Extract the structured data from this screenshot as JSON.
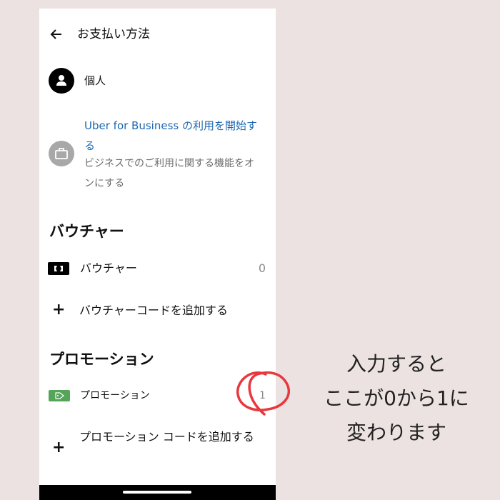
{
  "header": {
    "title": "お支払い方法",
    "back_icon": "arrow-left-icon"
  },
  "personal": {
    "label": "個人",
    "icon": "person-icon"
  },
  "uber_business": {
    "title": "Uber for Business の利用を開始する",
    "subtitle": "ビジネスでのご利用に関する機能をオンにする",
    "icon": "briefcase-icon"
  },
  "voucher_section": {
    "heading": "バウチャー",
    "item_label": "バウチャー",
    "count": "0",
    "add_label": "バウチャーコードを追加する",
    "add_icon": "plus-icon",
    "item_icon": "ticket-icon"
  },
  "promo_section": {
    "heading": "プロモーション",
    "item_label": "プロモーション",
    "count": "1",
    "add_label": "プロモーション コードを追加する",
    "add_icon": "plus-icon",
    "item_icon": "tag-icon",
    "tag_color": "#54a45a"
  },
  "annotation": {
    "lines": [
      "入力すると",
      "ここが0から1に",
      "変わります"
    ],
    "circle_color": "#e8383d"
  },
  "colors": {
    "link": "#1d68b3",
    "background": "#ede2e2"
  }
}
